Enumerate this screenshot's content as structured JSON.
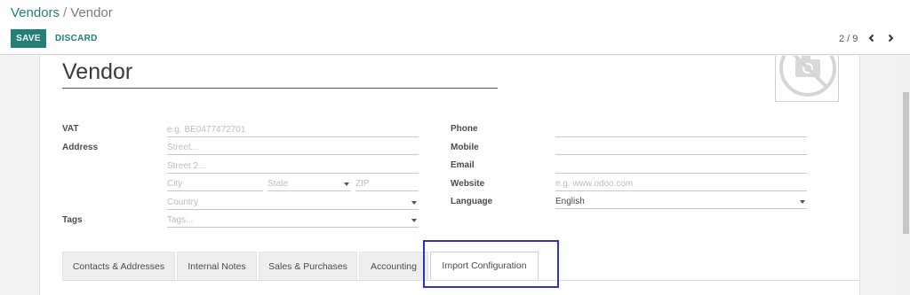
{
  "breadcrumb": {
    "parent": "Vendors",
    "separator": "/",
    "current": "Vendor"
  },
  "toolbar": {
    "save_label": "SAVE",
    "discard_label": "DISCARD"
  },
  "pager": {
    "text": "2 / 9"
  },
  "form": {
    "name": "Vendor",
    "left": {
      "vat_label": "VAT",
      "vat_placeholder": "e.g. BE0477472701",
      "address_label": "Address",
      "street_placeholder": "Street...",
      "street2_placeholder": "Street 2...",
      "city_placeholder": "City",
      "state_placeholder": "State",
      "zip_placeholder": "ZIP",
      "country_placeholder": "Country",
      "tags_label": "Tags",
      "tags_placeholder": "Tags..."
    },
    "right": {
      "phone_label": "Phone",
      "mobile_label": "Mobile",
      "email_label": "Email",
      "website_label": "Website",
      "website_placeholder": "e.g. www.odoo.com",
      "language_label": "Language",
      "language_value": "English"
    }
  },
  "tabs": [
    {
      "label": "Contacts & Addresses"
    },
    {
      "label": "Internal Notes"
    },
    {
      "label": "Sales & Purchases"
    },
    {
      "label": "Accounting"
    },
    {
      "label": "Import Configuration"
    }
  ],
  "colors": {
    "accent": "#21807a",
    "highlight": "#2f2fd6"
  },
  "icons": {
    "avatar": "camera-placeholder-icon",
    "prev": "chevron-left-icon",
    "next": "chevron-right-icon"
  }
}
